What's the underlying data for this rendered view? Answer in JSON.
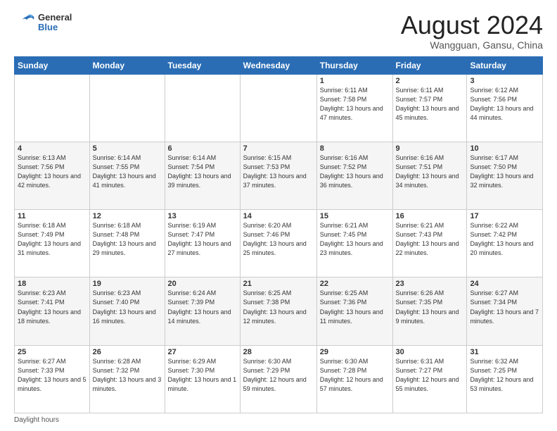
{
  "logo": {
    "line1": "General",
    "line2": "Blue"
  },
  "title": "August 2024",
  "location": "Wangguan, Gansu, China",
  "days_of_week": [
    "Sunday",
    "Monday",
    "Tuesday",
    "Wednesday",
    "Thursday",
    "Friday",
    "Saturday"
  ],
  "footer_text": "Daylight hours",
  "weeks": [
    [
      {
        "day": "",
        "info": ""
      },
      {
        "day": "",
        "info": ""
      },
      {
        "day": "",
        "info": ""
      },
      {
        "day": "",
        "info": ""
      },
      {
        "day": "1",
        "info": "Sunrise: 6:11 AM\nSunset: 7:58 PM\nDaylight: 13 hours and 47 minutes."
      },
      {
        "day": "2",
        "info": "Sunrise: 6:11 AM\nSunset: 7:57 PM\nDaylight: 13 hours and 45 minutes."
      },
      {
        "day": "3",
        "info": "Sunrise: 6:12 AM\nSunset: 7:56 PM\nDaylight: 13 hours and 44 minutes."
      }
    ],
    [
      {
        "day": "4",
        "info": "Sunrise: 6:13 AM\nSunset: 7:56 PM\nDaylight: 13 hours and 42 minutes."
      },
      {
        "day": "5",
        "info": "Sunrise: 6:14 AM\nSunset: 7:55 PM\nDaylight: 13 hours and 41 minutes."
      },
      {
        "day": "6",
        "info": "Sunrise: 6:14 AM\nSunset: 7:54 PM\nDaylight: 13 hours and 39 minutes."
      },
      {
        "day": "7",
        "info": "Sunrise: 6:15 AM\nSunset: 7:53 PM\nDaylight: 13 hours and 37 minutes."
      },
      {
        "day": "8",
        "info": "Sunrise: 6:16 AM\nSunset: 7:52 PM\nDaylight: 13 hours and 36 minutes."
      },
      {
        "day": "9",
        "info": "Sunrise: 6:16 AM\nSunset: 7:51 PM\nDaylight: 13 hours and 34 minutes."
      },
      {
        "day": "10",
        "info": "Sunrise: 6:17 AM\nSunset: 7:50 PM\nDaylight: 13 hours and 32 minutes."
      }
    ],
    [
      {
        "day": "11",
        "info": "Sunrise: 6:18 AM\nSunset: 7:49 PM\nDaylight: 13 hours and 31 minutes."
      },
      {
        "day": "12",
        "info": "Sunrise: 6:18 AM\nSunset: 7:48 PM\nDaylight: 13 hours and 29 minutes."
      },
      {
        "day": "13",
        "info": "Sunrise: 6:19 AM\nSunset: 7:47 PM\nDaylight: 13 hours and 27 minutes."
      },
      {
        "day": "14",
        "info": "Sunrise: 6:20 AM\nSunset: 7:46 PM\nDaylight: 13 hours and 25 minutes."
      },
      {
        "day": "15",
        "info": "Sunrise: 6:21 AM\nSunset: 7:45 PM\nDaylight: 13 hours and 23 minutes."
      },
      {
        "day": "16",
        "info": "Sunrise: 6:21 AM\nSunset: 7:43 PM\nDaylight: 13 hours and 22 minutes."
      },
      {
        "day": "17",
        "info": "Sunrise: 6:22 AM\nSunset: 7:42 PM\nDaylight: 13 hours and 20 minutes."
      }
    ],
    [
      {
        "day": "18",
        "info": "Sunrise: 6:23 AM\nSunset: 7:41 PM\nDaylight: 13 hours and 18 minutes."
      },
      {
        "day": "19",
        "info": "Sunrise: 6:23 AM\nSunset: 7:40 PM\nDaylight: 13 hours and 16 minutes."
      },
      {
        "day": "20",
        "info": "Sunrise: 6:24 AM\nSunset: 7:39 PM\nDaylight: 13 hours and 14 minutes."
      },
      {
        "day": "21",
        "info": "Sunrise: 6:25 AM\nSunset: 7:38 PM\nDaylight: 13 hours and 12 minutes."
      },
      {
        "day": "22",
        "info": "Sunrise: 6:25 AM\nSunset: 7:36 PM\nDaylight: 13 hours and 11 minutes."
      },
      {
        "day": "23",
        "info": "Sunrise: 6:26 AM\nSunset: 7:35 PM\nDaylight: 13 hours and 9 minutes."
      },
      {
        "day": "24",
        "info": "Sunrise: 6:27 AM\nSunset: 7:34 PM\nDaylight: 13 hours and 7 minutes."
      }
    ],
    [
      {
        "day": "25",
        "info": "Sunrise: 6:27 AM\nSunset: 7:33 PM\nDaylight: 13 hours and 5 minutes."
      },
      {
        "day": "26",
        "info": "Sunrise: 6:28 AM\nSunset: 7:32 PM\nDaylight: 13 hours and 3 minutes."
      },
      {
        "day": "27",
        "info": "Sunrise: 6:29 AM\nSunset: 7:30 PM\nDaylight: 13 hours and 1 minute."
      },
      {
        "day": "28",
        "info": "Sunrise: 6:30 AM\nSunset: 7:29 PM\nDaylight: 12 hours and 59 minutes."
      },
      {
        "day": "29",
        "info": "Sunrise: 6:30 AM\nSunset: 7:28 PM\nDaylight: 12 hours and 57 minutes."
      },
      {
        "day": "30",
        "info": "Sunrise: 6:31 AM\nSunset: 7:27 PM\nDaylight: 12 hours and 55 minutes."
      },
      {
        "day": "31",
        "info": "Sunrise: 6:32 AM\nSunset: 7:25 PM\nDaylight: 12 hours and 53 minutes."
      }
    ]
  ]
}
